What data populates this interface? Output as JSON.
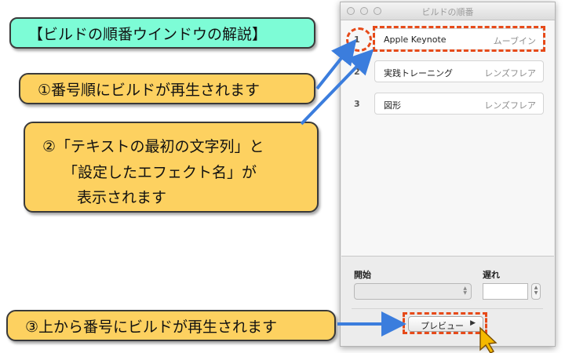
{
  "callouts": {
    "title": "【ビルドの順番ウインドウの解説】",
    "note1": "①番号順にビルドが再生されます",
    "note2_line1": "②「テキストの最初の文字列」と",
    "note2_line2": "「設定したエフェクト名」が",
    "note2_line3": "表示されます",
    "note3": "③上から番号にビルドが再生されます"
  },
  "window": {
    "title": "ビルドの順番",
    "builds": [
      {
        "number": "1",
        "text": "Apple Keynote",
        "effect": "ムーブイン"
      },
      {
        "number": "2",
        "text": "実践トレーニング",
        "effect": "レンズフレア"
      },
      {
        "number": "3",
        "text": "図形",
        "effect": "レンズフレア"
      }
    ],
    "start_label": "開始",
    "delay_label": "遅れ",
    "start_value": "",
    "delay_value": "",
    "preview_label": "プレビュー",
    "preview_icon": "▶"
  },
  "colors": {
    "title_callout": "#7dfcd6",
    "note_callout": "#fdd160",
    "arrow": "#3b7ddd",
    "highlight": "#e64a19"
  }
}
